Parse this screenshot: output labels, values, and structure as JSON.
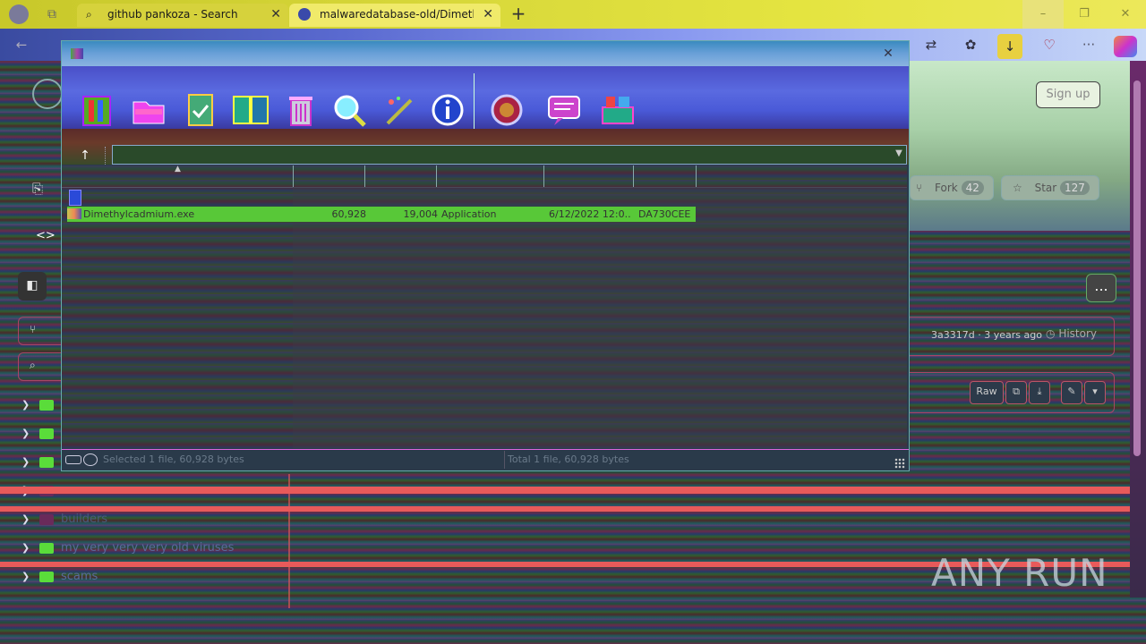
{
  "browser": {
    "tabs": [
      {
        "label": "github pankoza - Search",
        "active": false
      },
      {
        "label": "malwaredatabase-old/Dimethylc",
        "active": true
      }
    ],
    "new_tab": "+",
    "window_controls": {
      "minimize": "–",
      "maximize": "❐",
      "close": "✕"
    }
  },
  "page": {
    "sign_up": "Sign up",
    "fork_label": "Fork",
    "fork_count": "42",
    "star_label": "Star",
    "star_count": "127",
    "more_button": "...",
    "commit_info": "3a3317d · 3 years ago",
    "history_label": "History",
    "raw_label": "Raw",
    "code_icon": "<>",
    "tree": [
      {
        "name": "my very very very old viruses"
      },
      {
        "name": "builders"
      },
      {
        "name": "scams"
      }
    ]
  },
  "app": {
    "toolbar_icons": [
      "archive-add-icon",
      "extract-icon",
      "test-icon",
      "copy-icon",
      "delete-icon",
      "find-icon",
      "wizard-icon",
      "info-icon",
      "virus-scan-icon",
      "comment-icon",
      "sfx-icon"
    ],
    "up_button": "↑",
    "path_value": "",
    "file": {
      "name": "Dimethylcadmium.exe",
      "size": "60,928",
      "packed": "19,004",
      "type": "Application",
      "modified": "6/12/2022 12:0...",
      "crc": "DA730CEE"
    },
    "status_selected": "Selected 1 file, 60,928 bytes",
    "status_total": "Total 1 file, 60,928 bytes"
  },
  "watermark": "ANY RUN",
  "colors": {
    "selected_row": "#58c838",
    "toolbar_bg": "#4a5ad8",
    "tabbar_bg": "#d8d83a"
  }
}
